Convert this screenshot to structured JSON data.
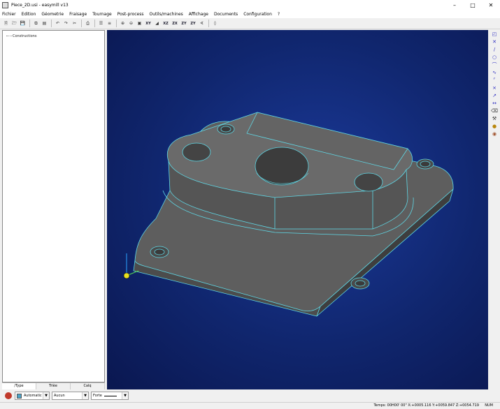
{
  "window": {
    "title": "Piece_2D.usi - easymill v13"
  },
  "menu": [
    "Fichier",
    "Edition",
    "Géometrie",
    "Fraisage",
    "Tournage",
    "Post-process",
    "Outils/machines",
    "Affichage",
    "Documents",
    "Configuration",
    "?"
  ],
  "toolbar": {
    "view_labels": [
      "XY",
      "XZ",
      "ZX",
      "ZY",
      "ZY"
    ]
  },
  "tree": {
    "root": "Constructions"
  },
  "tabs": [
    "/Type",
    "Trièe",
    "Calq"
  ],
  "bottom": {
    "color_mode": "Automatic",
    "line_combo": "Aucun",
    "line_style_label": "Forte"
  },
  "status": {
    "text": "Temps: 00H00' 00\"  X:+0005.116 Y:+0059.847 Z:+0054.719",
    "num": "NUM"
  },
  "colors": {
    "viewport_bg": "#10266e",
    "part_face": "#5e5e5e",
    "edge": "#5fd8e6"
  }
}
